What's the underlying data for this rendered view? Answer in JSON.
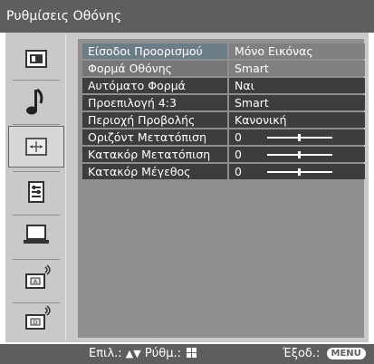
{
  "title": "Ρυθμίσεις Οθόνης",
  "sidebar": {
    "items": [
      {
        "name": "picture-icon",
        "selected": false
      },
      {
        "name": "sound-icon",
        "selected": false
      },
      {
        "name": "screen-icon",
        "selected": true
      },
      {
        "name": "features-icon",
        "selected": false
      },
      {
        "name": "pc-icon",
        "selected": false
      },
      {
        "name": "analog-setup-icon",
        "selected": false
      },
      {
        "name": "digital-setup-icon",
        "selected": false
      }
    ]
  },
  "settings": [
    {
      "label": "Είσοδοι Προορισμού",
      "value": "Μόνο Εικόνας",
      "type": "text"
    },
    {
      "label": "Φορμά Οθόνης",
      "value": "Smart",
      "type": "text"
    },
    {
      "label": "Αυτόματο Φορμά",
      "value": "Ναι",
      "type": "text"
    },
    {
      "label": "Προεπιλογή 4:3",
      "value": "Smart",
      "type": "text"
    },
    {
      "label": "Περιοχή Προβολής",
      "value": "Κανονική",
      "type": "text"
    },
    {
      "label": "Οριζόντ Μετατόπιση",
      "value": "0",
      "type": "slider",
      "level": 0.5
    },
    {
      "label": "Κατακόρ Μετατόπιση",
      "value": "0",
      "type": "slider",
      "level": 0.5
    },
    {
      "label": "Κατακόρ Μέγεθος",
      "value": "0",
      "type": "slider",
      "level": 0.5
    }
  ],
  "footer": {
    "select_label": "Επιλ.:",
    "adjust_label": "Ρύθμ.:",
    "exit_label": "Έξοδ.:",
    "menu_key": "MENU",
    "up_arrow": "▲",
    "down_arrow": "▼"
  },
  "colors": {
    "title_bg": "#5e5e5e",
    "frame_bg": "#c9c9c9",
    "content_bg": "#8f8f8f",
    "highlight_bg": "#3d3d3d",
    "text": "#ffffff"
  }
}
